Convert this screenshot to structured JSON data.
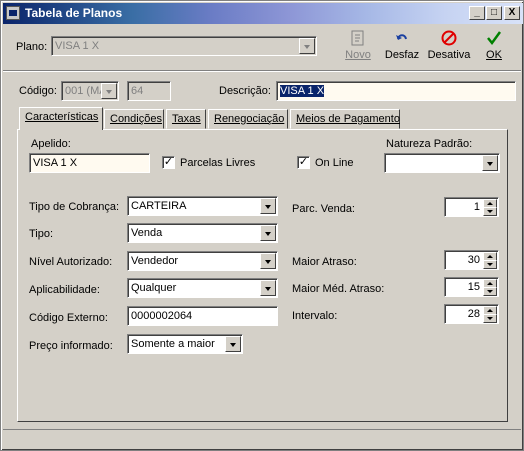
{
  "window": {
    "title": "Tabela de Planos"
  },
  "titlebar_buttons": {
    "minimize": "_",
    "maximize": "□",
    "close": "X"
  },
  "toolbar": {
    "plano_label": "Plano:",
    "plano_value": "VISA 1 X",
    "novo": "Novo",
    "desfaz": "Desfaz",
    "desativa": "Desativa",
    "ok": "OK"
  },
  "header": {
    "codigo_label": "Código:",
    "codigo_combo": "001 (MA",
    "codigo_num": "64",
    "descricao_label": "Descrição:",
    "descricao_value": "VISA 1 X"
  },
  "tabs": [
    {
      "label": "Características",
      "active": true
    },
    {
      "label": "Condições"
    },
    {
      "label": "Taxas"
    },
    {
      "label": "Renegociação"
    },
    {
      "label": "Meios de Pagamento"
    }
  ],
  "caracteristicas": {
    "apelido_label": "Apelido:",
    "apelido_value": "VISA 1 X",
    "parcelas_livres_label": "Parcelas Livres",
    "parcelas_livres_checked": true,
    "online_label": "On Line",
    "online_checked": true,
    "natureza_label": "Natureza Padrão:",
    "natureza_value": "",
    "tipo_cobranca_label": "Tipo de Cobrança:",
    "tipo_cobranca_value": "CARTEIRA",
    "tipo_label": "Tipo:",
    "tipo_value": "Venda",
    "nivel_label": "Nível Autorizado:",
    "nivel_value": "Vendedor",
    "aplicabilidade_label": "Aplicabilidade:",
    "aplicabilidade_value": "Qualquer",
    "codigo_externo_label": "Código Externo:",
    "codigo_externo_value": "0000002064",
    "preco_label": "Preço informado:",
    "preco_value": "Somente a maior",
    "parc_venda_label": "Parc. Venda:",
    "parc_venda_value": "1",
    "maior_atraso_label": "Maior Atraso:",
    "maior_atraso_value": "30",
    "maior_med_label": "Maior Méd. Atraso:",
    "maior_med_value": "15",
    "intervalo_label": "Intervalo:",
    "intervalo_value": "28"
  },
  "colors": {
    "title_start": "#0a246a",
    "face": "#d4d0c8",
    "highlight": "#0a246a",
    "cream": "#fffaf0",
    "desativa_red": "#e00000",
    "ok_green": "#008000"
  }
}
